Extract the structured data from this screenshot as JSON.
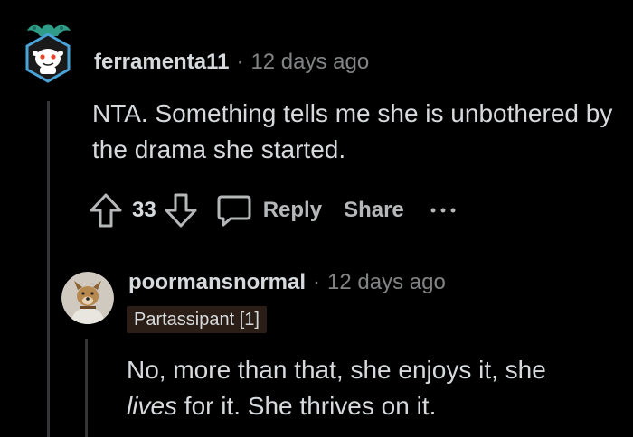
{
  "comment": {
    "author": "ferramenta11",
    "separator": "·",
    "time": "12 days ago",
    "body": "NTA. Something tells me she is unbothered by the drama she started.",
    "avatar_icon": "snoo-avatar-icon",
    "actions": {
      "upvote_icon": "upvote-arrow-icon",
      "score": "33",
      "downvote_icon": "downvote-arrow-icon",
      "reply_icon": "speech-bubble-icon",
      "reply_label": "Reply",
      "share_label": "Share",
      "more_icon": "more-dots-icon"
    }
  },
  "reply": {
    "author": "poormansnormal",
    "separator": "·",
    "time": "12 days ago",
    "flair": "Partassipant [1]",
    "body_part1": "No, more than that, she enjoys it, she",
    "body_emphasis": "lives",
    "body_part2": " for it. She thrives on it.",
    "avatar_icon": "dog-avatar-icon"
  },
  "colors": {
    "background": "#000000",
    "text_primary": "#d7dadc",
    "text_meta": "#818384",
    "action_text": "#b5b7b9",
    "thread_line": "#343536",
    "flair_bg": "#2a1e16",
    "avatar_ring": "#4aa3d6"
  }
}
